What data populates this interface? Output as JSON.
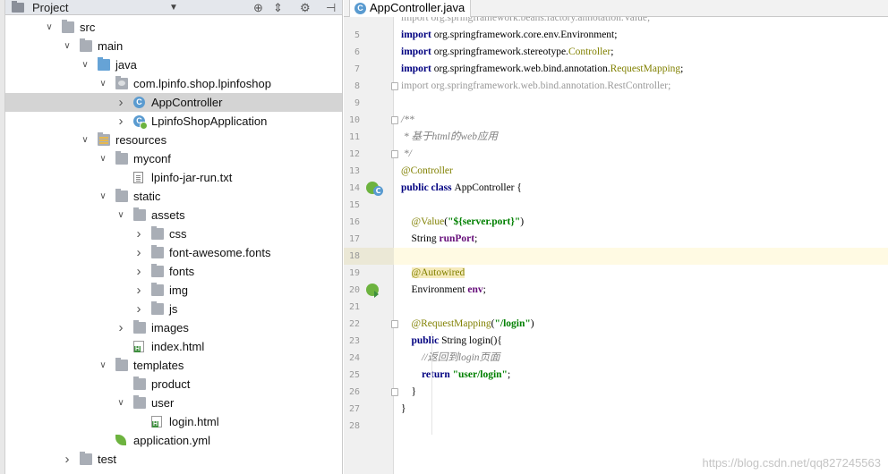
{
  "project_panel": {
    "title": "Project",
    "dropdown_arrow": "▼",
    "toolbar_icons": [
      "target-icon",
      "collapse-icon",
      "gear-icon",
      "hide-icon"
    ],
    "tree": [
      {
        "label": "src",
        "depth": 0,
        "expanded": true,
        "icon": "folder-icon"
      },
      {
        "label": "main",
        "depth": 1,
        "expanded": true,
        "icon": "folder-icon"
      },
      {
        "label": "java",
        "depth": 2,
        "expanded": true,
        "icon": "source-folder-icon"
      },
      {
        "label": "com.lpinfo.shop.lpinfoshop",
        "depth": 3,
        "expanded": true,
        "icon": "package-icon"
      },
      {
        "label": "AppController",
        "depth": 4,
        "expanded": false,
        "icon": "class-icon",
        "selected": true
      },
      {
        "label": "LpinfoShopApplication",
        "depth": 4,
        "expanded": false,
        "icon": "spring-class-icon"
      },
      {
        "label": "resources",
        "depth": 2,
        "expanded": true,
        "icon": "resources-folder-icon"
      },
      {
        "label": "myconf",
        "depth": 3,
        "expanded": true,
        "icon": "folder-icon"
      },
      {
        "label": "lpinfo-jar-run.txt",
        "depth": 4,
        "icon": "text-file-icon"
      },
      {
        "label": "static",
        "depth": 3,
        "expanded": true,
        "icon": "folder-icon"
      },
      {
        "label": "assets",
        "depth": 4,
        "expanded": true,
        "icon": "folder-icon"
      },
      {
        "label": "css",
        "depth": 5,
        "expanded": false,
        "icon": "folder-icon"
      },
      {
        "label": "font-awesome.fonts",
        "depth": 5,
        "expanded": false,
        "icon": "folder-icon"
      },
      {
        "label": "fonts",
        "depth": 5,
        "expanded": false,
        "icon": "folder-icon"
      },
      {
        "label": "img",
        "depth": 5,
        "expanded": false,
        "icon": "folder-icon"
      },
      {
        "label": "js",
        "depth": 5,
        "expanded": false,
        "icon": "folder-icon"
      },
      {
        "label": "images",
        "depth": 4,
        "expanded": false,
        "icon": "folder-icon"
      },
      {
        "label": "index.html",
        "depth": 4,
        "icon": "html-file-icon"
      },
      {
        "label": "templates",
        "depth": 3,
        "expanded": true,
        "icon": "folder-icon"
      },
      {
        "label": "product",
        "depth": 4,
        "icon": "folder-icon"
      },
      {
        "label": "user",
        "depth": 4,
        "expanded": true,
        "icon": "folder-icon"
      },
      {
        "label": "login.html",
        "depth": 5,
        "icon": "html-file-icon"
      },
      {
        "label": "application.yml",
        "depth": 3,
        "icon": "spring-config-icon"
      },
      {
        "label": "test",
        "depth": 1,
        "expanded": false,
        "icon": "folder-icon"
      }
    ]
  },
  "editor": {
    "tab_label": "AppController.java",
    "current_line": 18,
    "lines": [
      {
        "n": "",
        "tokens": [
          {
            "c": "dim",
            "t": "import org.springframework.beans.factory.annotation.Value;"
          }
        ]
      },
      {
        "n": "5",
        "tokens": [
          {
            "c": "kw",
            "t": "import "
          },
          {
            "c": "",
            "t": "org.springframework.core.env.Environment;"
          }
        ]
      },
      {
        "n": "6",
        "tokens": [
          {
            "c": "kw",
            "t": "import "
          },
          {
            "c": "",
            "t": "org.springframework.stereotype."
          },
          {
            "c": "ann",
            "t": "Controller"
          },
          {
            "c": "",
            "t": ";"
          }
        ]
      },
      {
        "n": "7",
        "tokens": [
          {
            "c": "kw",
            "t": "import "
          },
          {
            "c": "",
            "t": "org.springframework.web.bind.annotation."
          },
          {
            "c": "ann",
            "t": "RequestMapping"
          },
          {
            "c": "",
            "t": ";"
          }
        ]
      },
      {
        "n": "8",
        "tokens": [
          {
            "c": "dim",
            "t": "import org.springframework.web.bind.annotation.RestController;"
          }
        ]
      },
      {
        "n": "9",
        "tokens": []
      },
      {
        "n": "10",
        "tokens": [
          {
            "c": "cmt",
            "t": "/**"
          }
        ]
      },
      {
        "n": "11",
        "tokens": [
          {
            "c": "cmt",
            "t": " * 基于html的web应用"
          }
        ]
      },
      {
        "n": "12",
        "tokens": [
          {
            "c": "cmt",
            "t": " */"
          }
        ]
      },
      {
        "n": "13",
        "tokens": [
          {
            "c": "ann",
            "t": "@Controller"
          }
        ]
      },
      {
        "n": "14",
        "tokens": [
          {
            "c": "kw",
            "t": "public class "
          },
          {
            "c": "",
            "t": "AppController {"
          }
        ]
      },
      {
        "n": "15",
        "tokens": []
      },
      {
        "n": "16",
        "tokens": [
          {
            "c": "",
            "t": "    "
          },
          {
            "c": "ann",
            "t": "@Value"
          },
          {
            "c": "",
            "t": "("
          },
          {
            "c": "str",
            "t": "\"${server.port}\""
          },
          {
            "c": "",
            "t": ")"
          }
        ]
      },
      {
        "n": "17",
        "tokens": [
          {
            "c": "",
            "t": "    String "
          },
          {
            "c": "fld",
            "t": "runPort"
          },
          {
            "c": "",
            "t": ";"
          }
        ]
      },
      {
        "n": "18",
        "tokens": []
      },
      {
        "n": "19",
        "tokens": [
          {
            "c": "",
            "t": "    "
          },
          {
            "c": "autowired",
            "t": "@Autowired"
          }
        ]
      },
      {
        "n": "20",
        "tokens": [
          {
            "c": "",
            "t": "    Environment "
          },
          {
            "c": "fld",
            "t": "env"
          },
          {
            "c": "",
            "t": ";"
          }
        ]
      },
      {
        "n": "21",
        "tokens": []
      },
      {
        "n": "22",
        "tokens": [
          {
            "c": "",
            "t": "    "
          },
          {
            "c": "ann",
            "t": "@RequestMapping"
          },
          {
            "c": "",
            "t": "("
          },
          {
            "c": "str",
            "t": "\"/login\""
          },
          {
            "c": "",
            "t": ")"
          }
        ]
      },
      {
        "n": "23",
        "tokens": [
          {
            "c": "",
            "t": "    "
          },
          {
            "c": "kw",
            "t": "public "
          },
          {
            "c": "",
            "t": "String login(){"
          }
        ]
      },
      {
        "n": "24",
        "tokens": [
          {
            "c": "",
            "t": "        "
          },
          {
            "c": "cmt",
            "t": "//返回到login页面"
          }
        ]
      },
      {
        "n": "25",
        "tokens": [
          {
            "c": "",
            "t": "        "
          },
          {
            "c": "kw",
            "t": "return "
          },
          {
            "c": "str",
            "t": "\"user/login\""
          },
          {
            "c": "",
            "t": ";"
          }
        ]
      },
      {
        "n": "26",
        "tokens": [
          {
            "c": "",
            "t": "    }"
          }
        ]
      },
      {
        "n": "27",
        "tokens": [
          {
            "c": "",
            "t": "}"
          }
        ]
      },
      {
        "n": "28",
        "tokens": []
      }
    ]
  },
  "watermark": "https://blog.csdn.net/qq827245563",
  "colors": {
    "keyword": "#000080",
    "annotation": "#808000",
    "string": "#008000",
    "comment": "#808080",
    "selection": "#d4d4d4",
    "current_line": "#fffae3"
  }
}
